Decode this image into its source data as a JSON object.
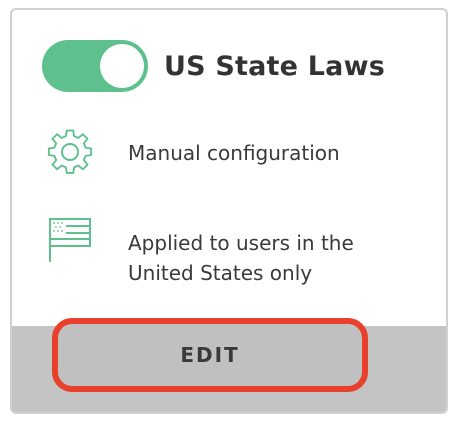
{
  "card": {
    "title": "US State Laws",
    "toggle_state": "on",
    "accent_color": "#5dc08d",
    "rows": [
      {
        "icon": "gear-icon",
        "text": "Manual configuration"
      },
      {
        "icon": "us-flag-icon",
        "text": "Applied to users in the United States only"
      }
    ],
    "edit_label": "EDIT",
    "highlight_color": "#e8402a"
  }
}
